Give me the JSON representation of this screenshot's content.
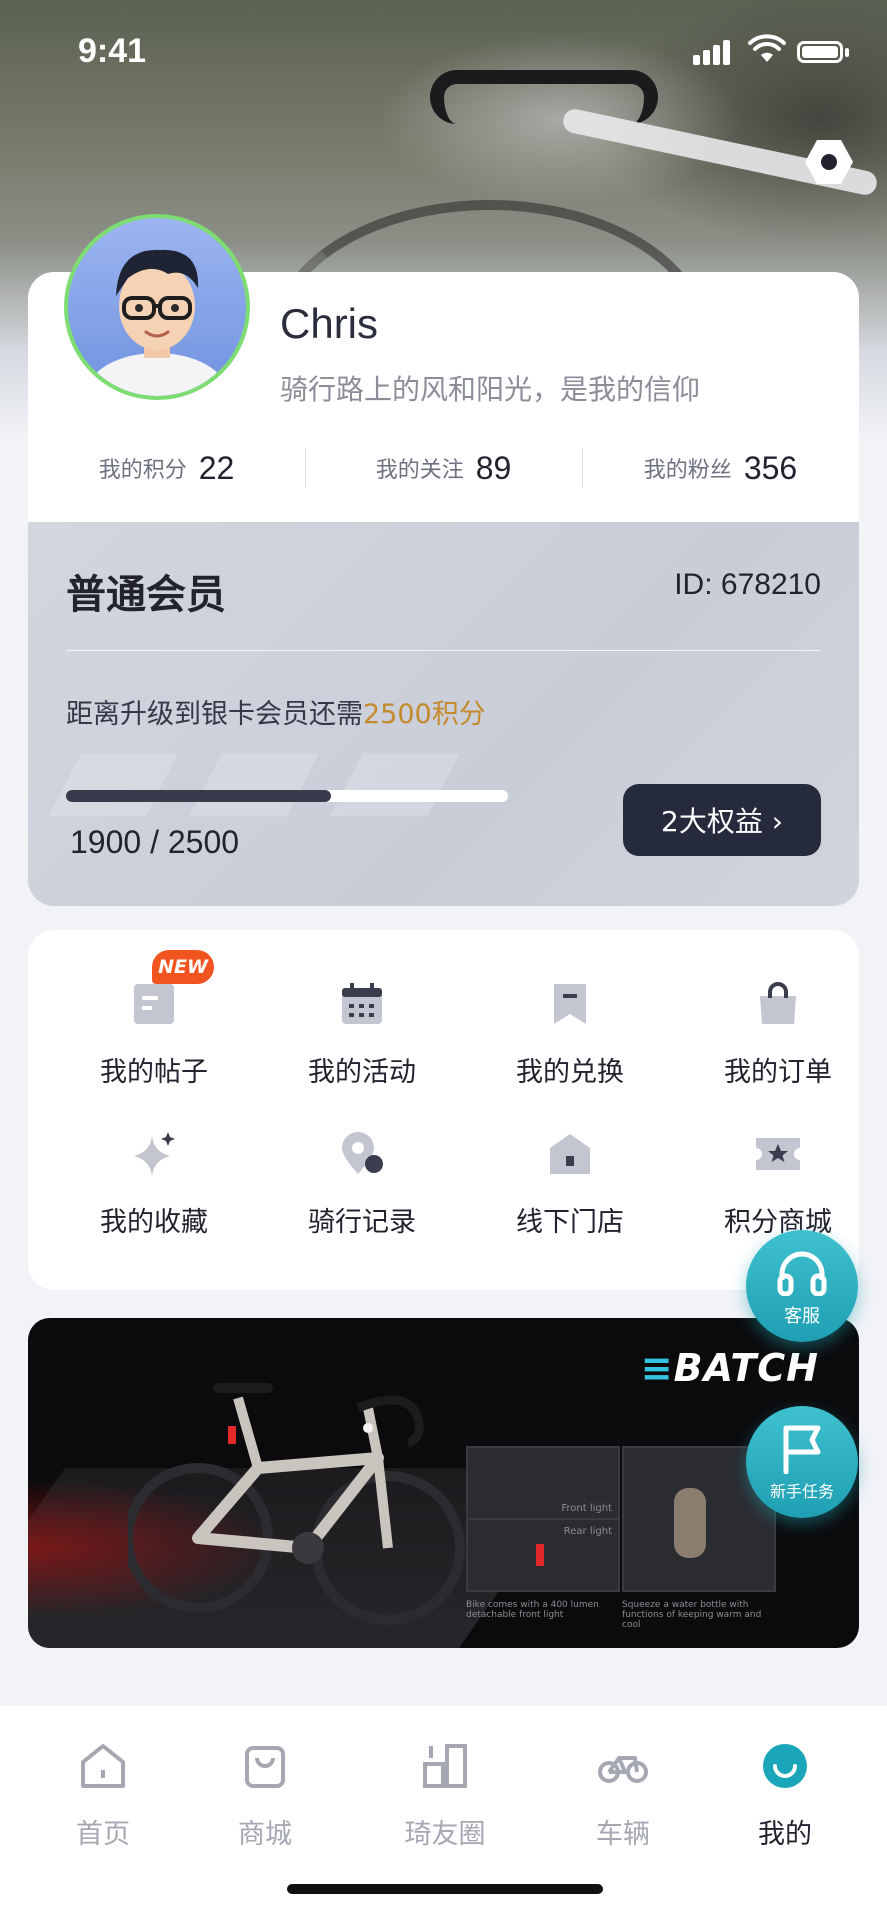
{
  "status_bar": {
    "time": "9:41"
  },
  "profile": {
    "name": "Chris",
    "motto": "骑行路上的风和阳光，是我的信仰",
    "stats": [
      {
        "label": "我的积分",
        "value": "22"
      },
      {
        "label": "我的关注",
        "value": "89"
      },
      {
        "label": "我的粉丝",
        "value": "356"
      }
    ]
  },
  "membership": {
    "title": "普通会员",
    "id_text": "ID: 678210",
    "upgrade_prefix": "距离升级到银卡会员还需",
    "upgrade_highlight": "2500积分",
    "progress_fraction": 0.6,
    "progress_text": "1900 / 2500",
    "benefits_button": "2大权益 ›",
    "accent_color": "#c58a2c"
  },
  "shortcuts": {
    "new_badge": "NEW",
    "items": [
      {
        "label": "我的帖子",
        "icon": "post-icon"
      },
      {
        "label": "我的活动",
        "icon": "calendar-icon"
      },
      {
        "label": "我的兑换",
        "icon": "bookmark-icon"
      },
      {
        "label": "我的订单",
        "icon": "shopping-bag-icon"
      },
      {
        "label": "我的收藏",
        "icon": "sparkle-icon"
      },
      {
        "label": "骑行记录",
        "icon": "location-pin-icon"
      },
      {
        "label": "线下门店",
        "icon": "store-icon"
      },
      {
        "label": "积分商城",
        "icon": "ticket-star-icon"
      }
    ]
  },
  "banner": {
    "logo": "BATCH",
    "captions": [
      "Front light",
      "Rear light",
      "Bike comes with a 400 lumen detachable front light",
      "Squeeze a water bottle with functions of keeping warm and cool"
    ]
  },
  "floating": {
    "service_label": "客服",
    "newbie_label": "新手任务"
  },
  "tabbar": {
    "tabs": [
      {
        "label": "首页",
        "icon": "home-icon"
      },
      {
        "label": "商城",
        "icon": "shop-icon"
      },
      {
        "label": "琦友圈",
        "icon": "community-icon"
      },
      {
        "label": "车辆",
        "icon": "bike-icon"
      },
      {
        "label": "我的",
        "icon": "profile-icon"
      }
    ],
    "active_index": 4,
    "active_color": "#1aa5b8"
  }
}
